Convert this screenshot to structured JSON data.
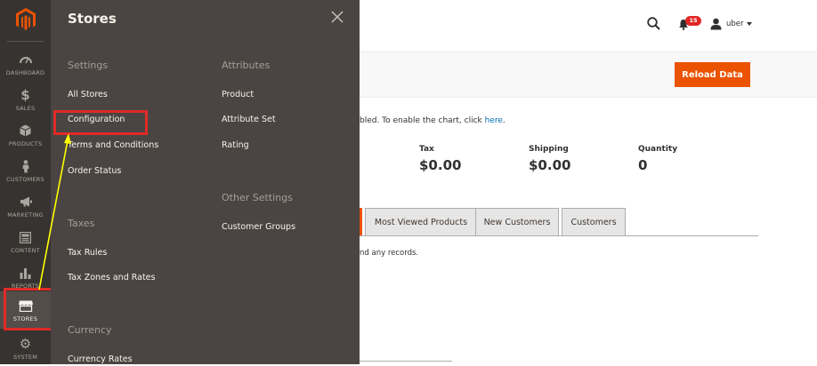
{
  "sidebar": {
    "items": [
      {
        "label": "DASHBOARD"
      },
      {
        "label": "SALES"
      },
      {
        "label": "PRODUCTS"
      },
      {
        "label": "CUSTOMERS"
      },
      {
        "label": "MARKETING"
      },
      {
        "label": "CONTENT"
      },
      {
        "label": "REPORTS"
      },
      {
        "label": "STORES"
      },
      {
        "label": "SYSTEM"
      }
    ],
    "active": "STORES",
    "icons": [
      "dashboard-icon",
      "dollar-icon",
      "cube-icon",
      "person-icon",
      "megaphone-icon",
      "content-icon",
      "bar-chart-icon",
      "store-icon",
      "gear-icon"
    ]
  },
  "panel": {
    "title": "Stores",
    "sections": {
      "settings": {
        "title": "Settings",
        "items": [
          "All Stores",
          "Configuration",
          "Terms and Conditions",
          "Order Status"
        ]
      },
      "taxes": {
        "title": "Taxes",
        "items": [
          "Tax Rules",
          "Tax Zones and Rates"
        ]
      },
      "currency": {
        "title": "Currency",
        "items": [
          "Currency Rates"
        ]
      },
      "attributes": {
        "title": "Attributes",
        "items": [
          "Product",
          "Attribute Set",
          "Rating"
        ]
      },
      "other": {
        "title": "Other Settings",
        "items": [
          "Customer Groups"
        ]
      }
    }
  },
  "header": {
    "notifications_count": "15",
    "user": "uber"
  },
  "dashboard": {
    "reload_label": "Reload Data",
    "notice_text": "bled. To enable the chart, click ",
    "notice_link": "here",
    "notice_end": ".",
    "totals": [
      {
        "label": "Tax",
        "value": "$0.00"
      },
      {
        "label": "Shipping",
        "value": "$0.00"
      },
      {
        "label": "Quantity",
        "value": "0"
      }
    ],
    "tabs": [
      "Most Viewed Products",
      "New Customers",
      "Customers"
    ],
    "empty_text": "nd any records."
  },
  "colors": {
    "accent": "#eb5202",
    "highlight": "#e02b27",
    "arrow": "#ffff00",
    "rail": "#373330",
    "panel": "#4a4542"
  }
}
